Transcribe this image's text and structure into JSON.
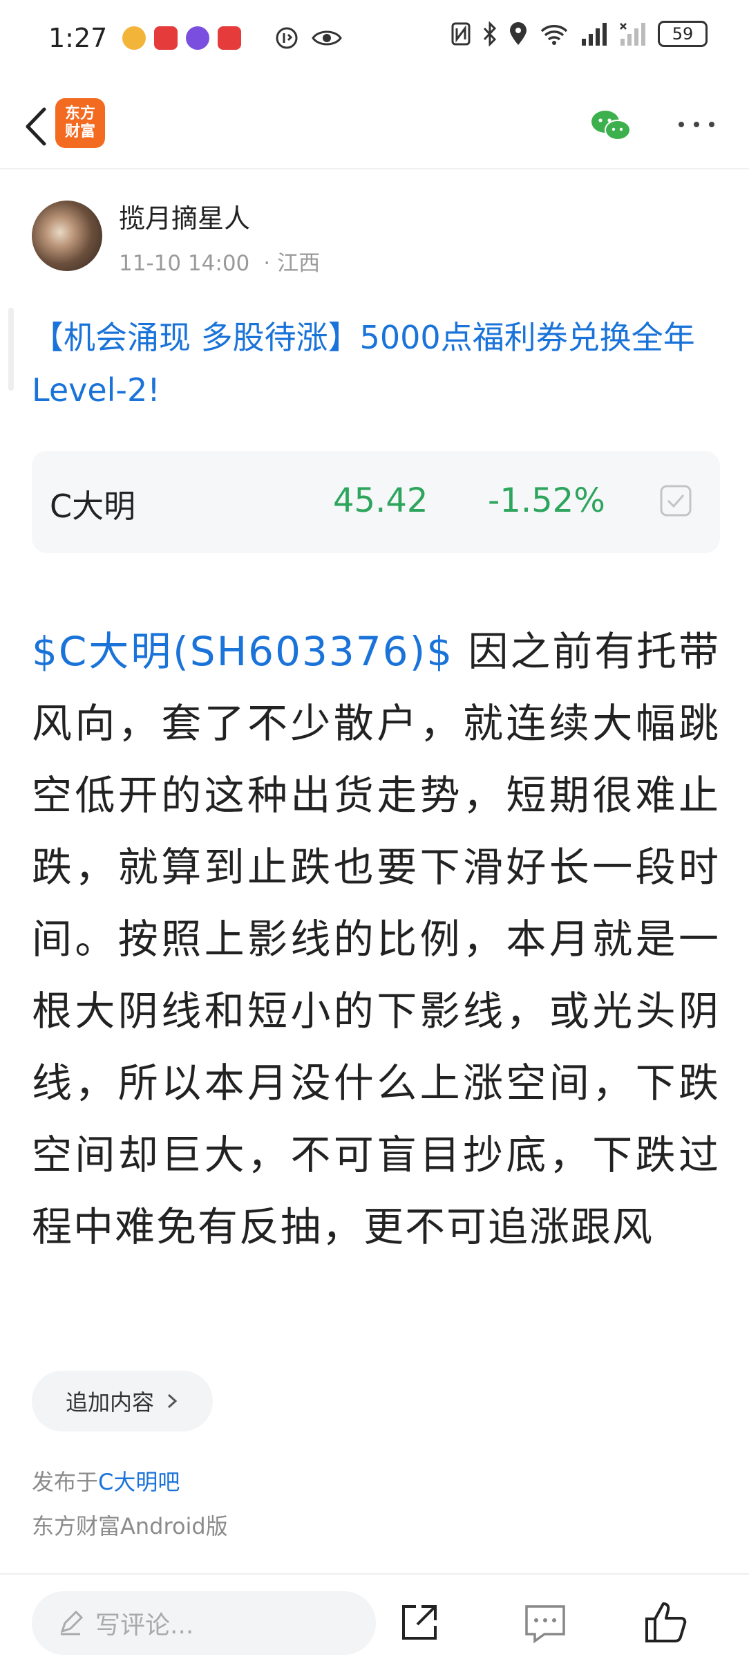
{
  "status_bar": {
    "time": "1:27",
    "battery": "59"
  },
  "nav": {
    "logo_line1": "东方",
    "logo_line2": "财富"
  },
  "author": {
    "name": "揽月摘星人",
    "datetime": "11-10 14:00",
    "location_sep": "·",
    "location": "江西"
  },
  "post": {
    "title": "【机会涌现 多股待涨】5000点福利券兑换全年Level-2!",
    "stock_link": "$C大明(SH603376)$",
    "body": " 因之前有托带风向，套了不少散户，就连续大幅跳空低开的这种出货走势，短期很难止跌，就算到止跌也要下滑好长一段时间。按照上影线的比例，本月就是一根大阴线和短小的下影线，或光头阴线，所以本月没什么上涨空间，下跌空间却巨大，不可盲目抄底，下跌过程中难免有反抽，更不可追涨跟风"
  },
  "stock_card": {
    "name": "C大明",
    "price": "45.42",
    "change": "-1.52%",
    "change_color": "#2da55d"
  },
  "footer": {
    "append_label": "追加内容",
    "published_prefix": "发布于",
    "published_bar": "C大明吧",
    "platform": "东方财富Android版"
  },
  "bottom_bar": {
    "comment_placeholder": "写评论..."
  },
  "colors": {
    "link": "#1a73d9",
    "brand": "#f36a21"
  }
}
